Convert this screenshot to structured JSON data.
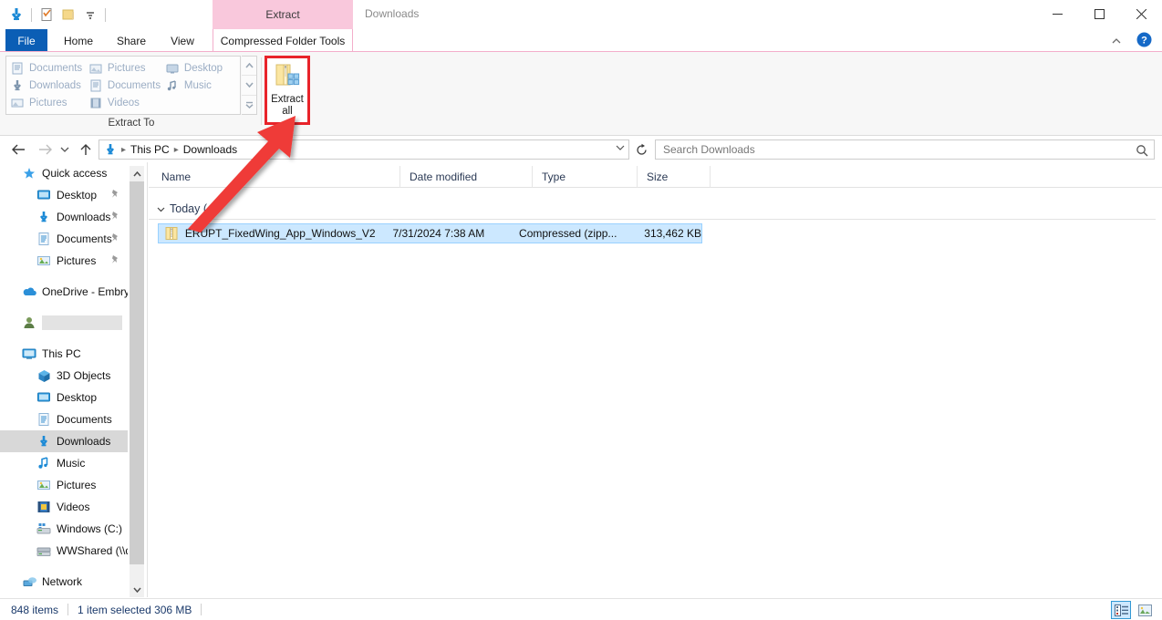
{
  "window": {
    "title": "Downloads",
    "contextual_tab_header": "Extract",
    "minimize_icon": "minimize-icon",
    "maximize_icon": "maximize-icon",
    "close_icon": "close-icon",
    "collapse_ribbon_icon": "chevron-up-icon",
    "help_icon": "help-icon"
  },
  "quick_access_toolbar": {
    "items": [
      {
        "name": "downloads-icon",
        "label": ""
      },
      {
        "name": "properties-icon",
        "label": ""
      },
      {
        "name": "new-folder-icon",
        "label": ""
      },
      {
        "name": "customize-dropdown-icon",
        "label": ""
      }
    ]
  },
  "tabs": [
    {
      "id": "file",
      "label": "File"
    },
    {
      "id": "home",
      "label": "Home"
    },
    {
      "id": "share",
      "label": "Share"
    },
    {
      "id": "view",
      "label": "View"
    },
    {
      "id": "compressed-folder-tools",
      "label": "Compressed Folder Tools"
    }
  ],
  "ribbon": {
    "group_label": "Extract To",
    "gallery": {
      "row1": [
        {
          "label": "Documents",
          "icon": "documents-icon"
        },
        {
          "label": "Pictures",
          "icon": "pictures-icon"
        },
        {
          "label": "Desktop",
          "icon": "desktop-icon"
        }
      ],
      "row2": [
        {
          "label": "Downloads",
          "icon": "downloads-icon"
        },
        {
          "label": "Documents",
          "icon": "documents-icon"
        },
        {
          "label": "Music",
          "icon": "music-icon"
        }
      ],
      "row3": [
        {
          "label": "Pictures",
          "icon": "pictures-icon"
        },
        {
          "label": "Videos",
          "icon": "videos-icon"
        }
      ]
    },
    "scroll_up_icon": "scroll-up-icon",
    "scroll_down_icon": "scroll-down-icon",
    "more_icon": "gallery-more-icon",
    "extract_all": {
      "line1": "Extract",
      "line2": "all",
      "icon": "extract-all-icon",
      "highlight_color": "#e8232a"
    }
  },
  "navigation": {
    "back_icon": "back-arrow-icon",
    "forward_icon": "forward-arrow-icon",
    "recent_icon": "recent-locations-icon",
    "up_icon": "up-arrow-icon",
    "address_icon": "downloads-icon",
    "breadcrumbs": [
      "This PC",
      "Downloads"
    ],
    "dropdown_icon": "chevron-down-icon",
    "refresh_icon": "refresh-icon"
  },
  "search": {
    "placeholder": "Search Downloads",
    "icon": "search-icon"
  },
  "columns": [
    {
      "label": "Name"
    },
    {
      "label": "Date modified"
    },
    {
      "label": "Type"
    },
    {
      "label": "Size"
    }
  ],
  "file_list": {
    "group": {
      "label": "Today (",
      "chevron_icon": "chevron-down-icon"
    },
    "rows": [
      {
        "icon": "zip-file-icon",
        "name": "ERUPT_FixedWing_App_Windows_V2",
        "date_modified": "7/31/2024 7:38 AM",
        "type": "Compressed (zipp...",
        "size": "313,462 KB",
        "selected": true
      }
    ]
  },
  "sidebar": {
    "items": [
      {
        "label": "Quick access",
        "icon": "quick-access-star-icon",
        "indent": 0,
        "pinned": false,
        "selected": false
      },
      {
        "label": "Desktop",
        "icon": "desktop-icon",
        "indent": 1,
        "pinned": true,
        "selected": false
      },
      {
        "label": "Downloads",
        "icon": "downloads-icon",
        "indent": 1,
        "pinned": true,
        "selected": false
      },
      {
        "label": "Documents",
        "icon": "documents-icon",
        "indent": 1,
        "pinned": true,
        "selected": false
      },
      {
        "label": "Pictures",
        "icon": "pictures-icon",
        "indent": 1,
        "pinned": true,
        "selected": false
      },
      {
        "label": "OneDrive - Embry",
        "icon": "onedrive-icon",
        "indent": 0,
        "pinned": false,
        "selected": false
      },
      {
        "label": "",
        "icon": "user-account-icon",
        "indent": 0,
        "pinned": false,
        "selected": false,
        "redacted": true
      },
      {
        "label": "This PC",
        "icon": "this-pc-icon",
        "indent": 0,
        "pinned": false,
        "selected": false
      },
      {
        "label": "3D Objects",
        "icon": "3d-objects-icon",
        "indent": 1,
        "pinned": false,
        "selected": false
      },
      {
        "label": "Desktop",
        "icon": "desktop-icon",
        "indent": 1,
        "pinned": false,
        "selected": false
      },
      {
        "label": "Documents",
        "icon": "documents-icon",
        "indent": 1,
        "pinned": false,
        "selected": false
      },
      {
        "label": "Downloads",
        "icon": "downloads-icon",
        "indent": 1,
        "pinned": false,
        "selected": true
      },
      {
        "label": "Music",
        "icon": "music-icon",
        "indent": 1,
        "pinned": false,
        "selected": false
      },
      {
        "label": "Pictures",
        "icon": "pictures-icon",
        "indent": 1,
        "pinned": false,
        "selected": false
      },
      {
        "label": "Videos",
        "icon": "videos-icon",
        "indent": 1,
        "pinned": false,
        "selected": false
      },
      {
        "label": "Windows (C:)",
        "icon": "local-disk-icon",
        "indent": 1,
        "pinned": false,
        "selected": false
      },
      {
        "label": "WWShared (\\\\db",
        "icon": "network-drive-icon",
        "indent": 1,
        "pinned": false,
        "selected": false
      },
      {
        "label": "Network",
        "icon": "network-icon",
        "indent": 0,
        "pinned": false,
        "selected": false
      }
    ],
    "scroll_up_icon": "scroll-up-icon",
    "scroll_down_icon": "scroll-down-icon"
  },
  "status_bar": {
    "item_count": "848 items",
    "selection": "1 item selected  306 MB",
    "details_view_icon": "details-view-icon",
    "large_icons_view_icon": "large-icons-view-icon"
  },
  "annotation": {
    "type": "arrow",
    "color": "#ef3b39",
    "points_to": "extract-all-button"
  }
}
